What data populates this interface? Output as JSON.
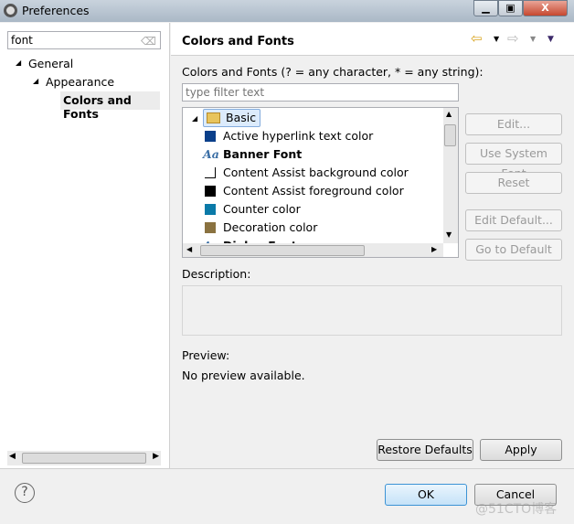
{
  "window": {
    "title": "Preferences",
    "minimize": "▁",
    "maximize": "▣",
    "close": "X"
  },
  "left": {
    "search_value": "font",
    "tree": [
      {
        "label": "General"
      },
      {
        "label": "Appearance"
      },
      {
        "label": "Colors and Fonts",
        "selected": true
      }
    ]
  },
  "page": {
    "title": "Colors and Fonts",
    "filter_label": "Colors and Fonts (? = any character, * = any string):",
    "filter_placeholder": "type filter text",
    "tree_root": "Basic",
    "items": [
      {
        "label": "Active hyperlink text color",
        "type": "color",
        "color": "#0a3f8a"
      },
      {
        "label": "Banner Font",
        "type": "font",
        "icon_text": "Aa"
      },
      {
        "label": "Content Assist background color",
        "type": "color",
        "color": "#ffffff"
      },
      {
        "label": "Content Assist foreground color",
        "type": "color",
        "color": "#000000"
      },
      {
        "label": "Counter color",
        "type": "color",
        "color": "#0a7aa8"
      },
      {
        "label": "Decoration color",
        "type": "color",
        "color": "#8a7240"
      },
      {
        "label": "Dialog Font",
        "type": "font",
        "icon_text": "Aa"
      }
    ],
    "buttons": {
      "edit": "Edit...",
      "system_font": "Use System Font",
      "reset": "Reset",
      "edit_default": "Edit Default...",
      "go_default": "Go to Default"
    },
    "description_label": "Description:",
    "preview_label": "Preview:",
    "preview_text": "No preview available.",
    "restore_defaults": "Restore Defaults",
    "apply": "Apply"
  },
  "footer": {
    "ok": "OK",
    "cancel": "Cancel",
    "help": "?",
    "watermark": "@51CTO博客"
  }
}
